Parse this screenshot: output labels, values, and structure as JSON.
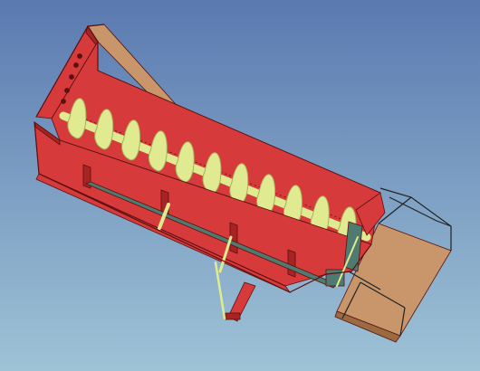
{
  "viewport": {
    "background_top": "#5a7ab0",
    "background_bottom": "#9ec3d6"
  },
  "model": {
    "colors": {
      "trough_red": "#d63a3a",
      "trough_dark": "#a82424",
      "trough_edge": "#5a1010",
      "flight_yellow": "#e0ea90",
      "flight_shadow": "#a8b060",
      "hopper_tan": "#c8966a",
      "hopper_dark": "#9a6a40",
      "frame_green": "#4f7a70",
      "wire_edge": "#222222"
    }
  }
}
